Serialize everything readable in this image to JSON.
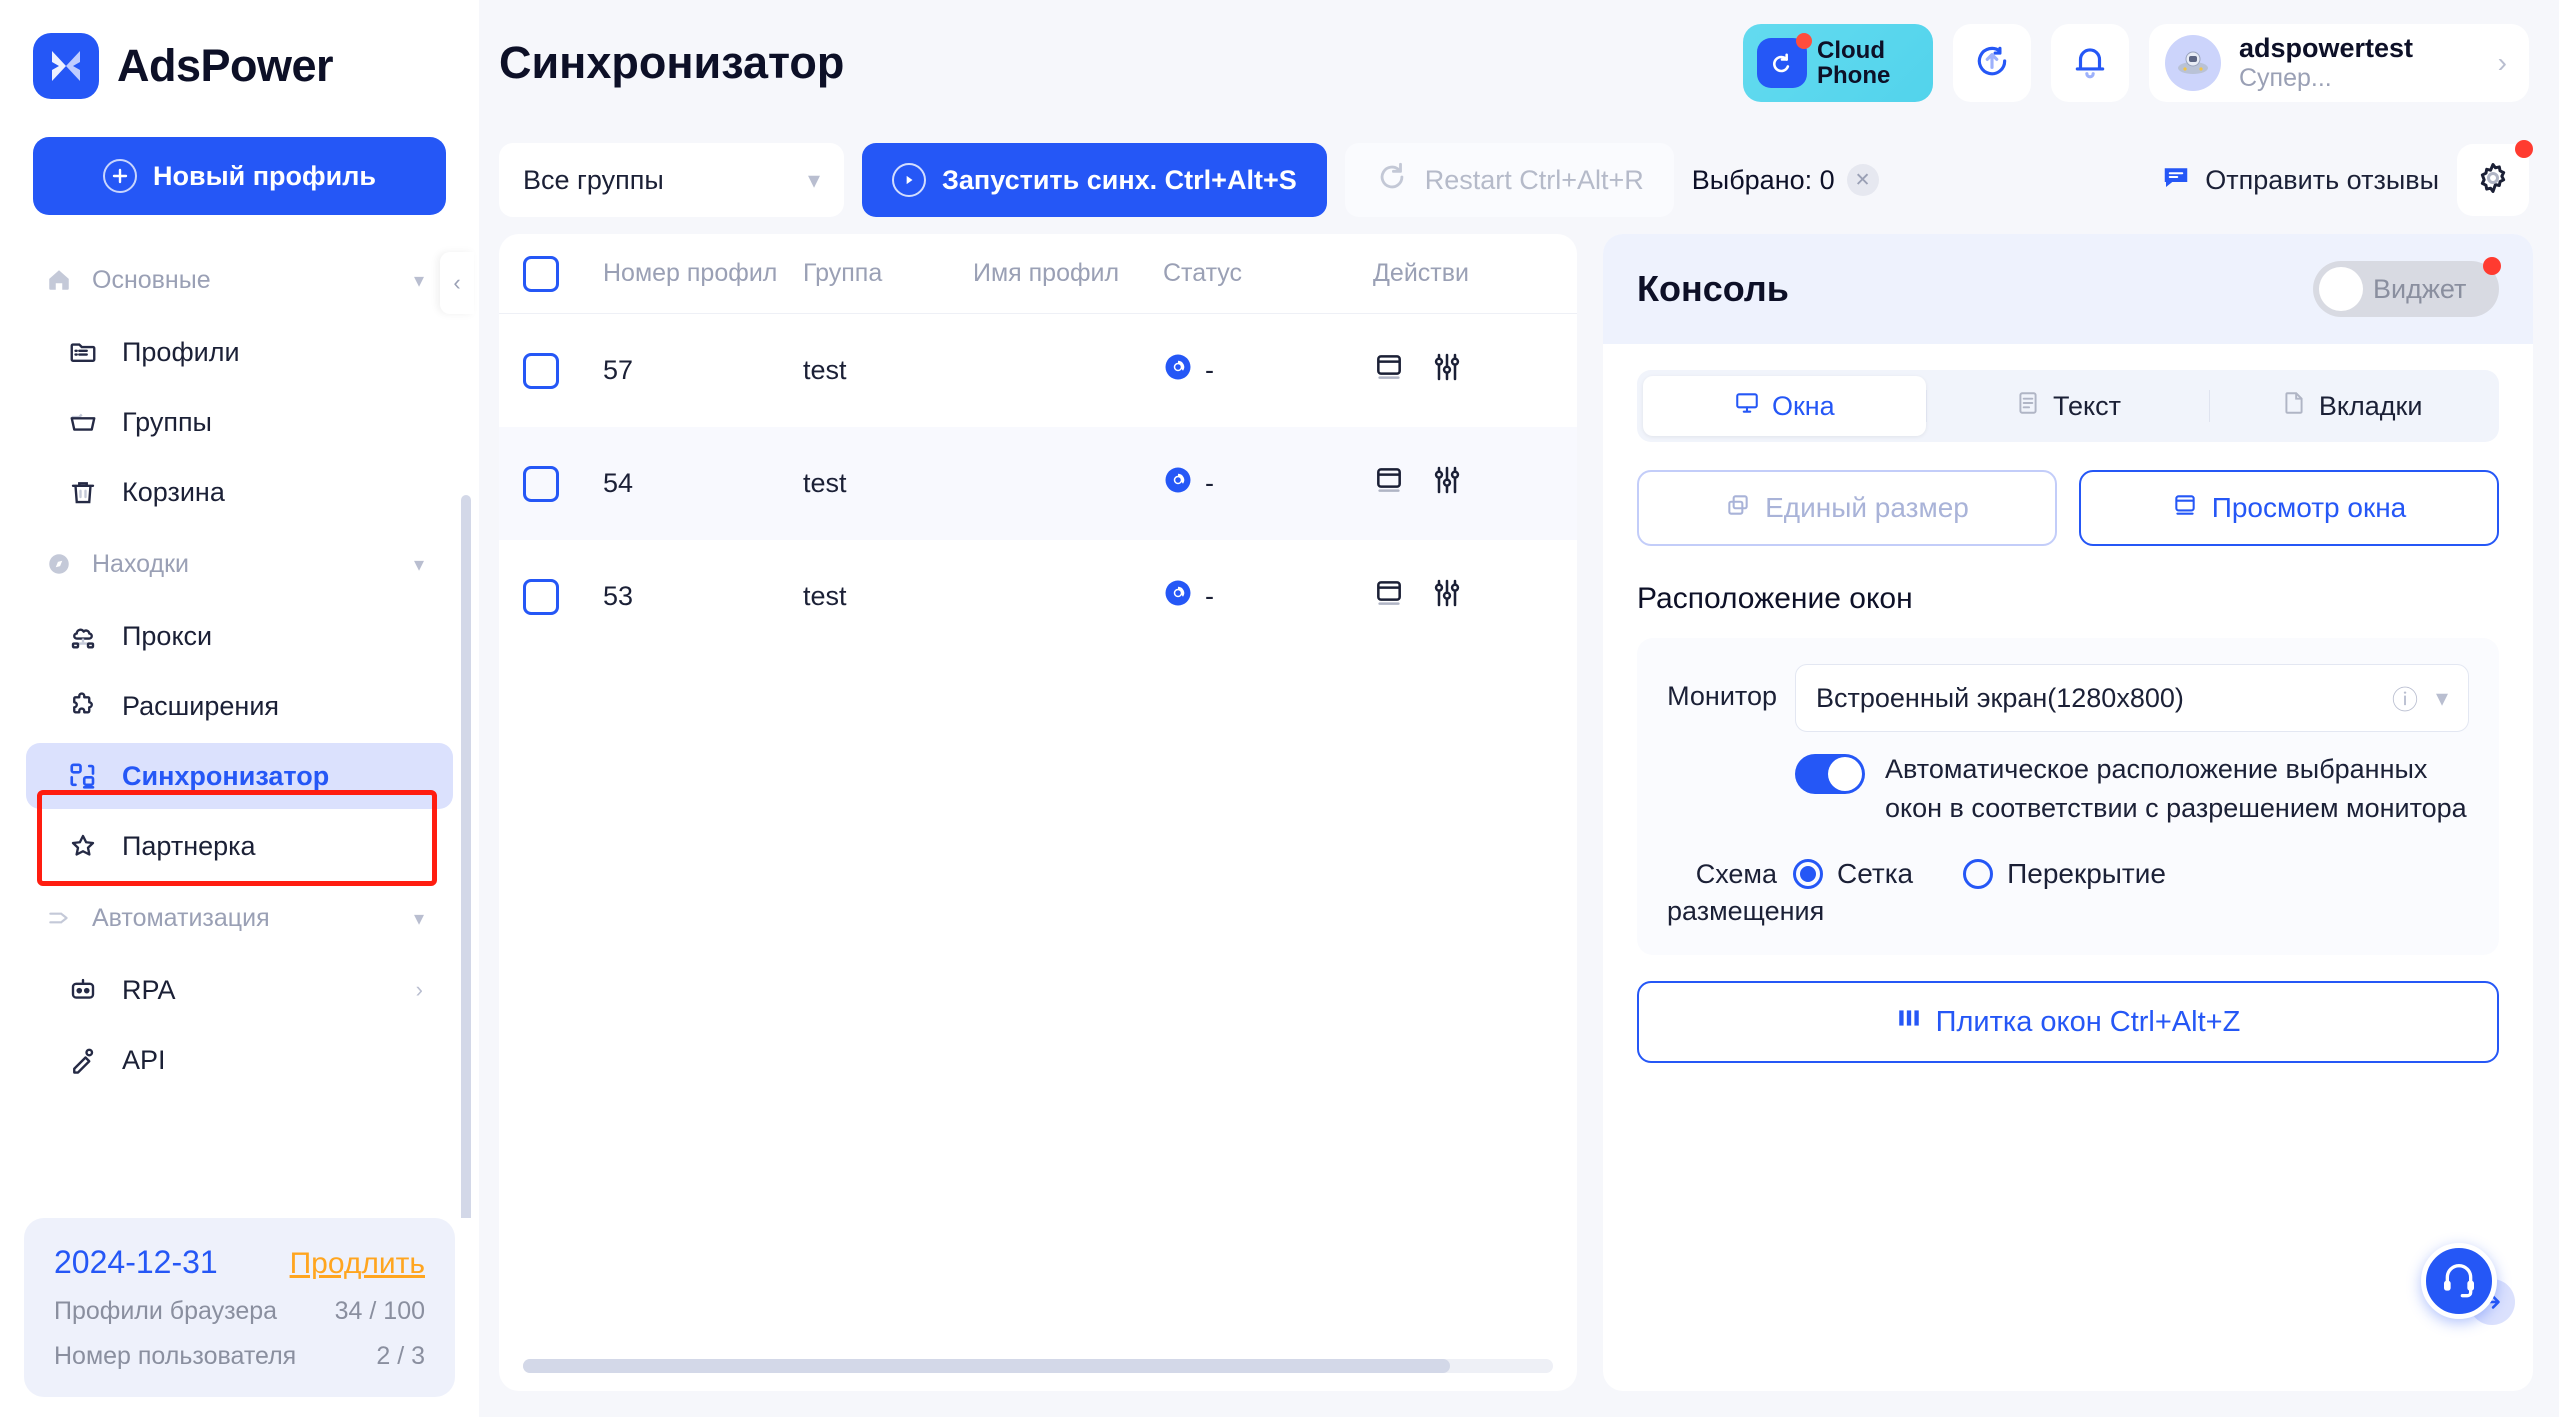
{
  "brand": {
    "name": "AdsPower",
    "logo_icon": "adspower-logo-icon"
  },
  "sidebar": {
    "new_profile_label": "Новый профиль",
    "groups": [
      {
        "title": "Основные",
        "icon": "home-icon",
        "items": [
          {
            "label": "Профили",
            "icon": "folder-list-icon"
          },
          {
            "label": "Группы",
            "icon": "folder-icon"
          },
          {
            "label": "Корзина",
            "icon": "trash-icon"
          }
        ]
      },
      {
        "title": "Находки",
        "icon": "compass-icon",
        "items": [
          {
            "label": "Прокси",
            "icon": "proxy-cloud-icon"
          },
          {
            "label": "Расширения",
            "icon": "puzzle-icon"
          },
          {
            "label": "Синхронизатор",
            "icon": "sync-grid-icon",
            "active": true
          },
          {
            "label": "Партнерка",
            "icon": "star-icon"
          }
        ]
      },
      {
        "title": "Автоматизация",
        "icon": "automation-icon",
        "items": [
          {
            "label": "RPA",
            "icon": "robot-icon",
            "has_submenu": true
          },
          {
            "label": "API",
            "icon": "api-icon"
          }
        ]
      }
    ],
    "plan": {
      "date": "2024-12-31",
      "renew_label": "Продлить",
      "rows": [
        {
          "label": "Профили браузера",
          "value": "34 / 100"
        },
        {
          "label": "Номер пользователя",
          "value": "2 / 3"
        }
      ]
    }
  },
  "header": {
    "title": "Синхронизатор",
    "cloud_phone": {
      "line1": "Cloud",
      "line2": "Phone",
      "icon": "cloud-phone-icon"
    },
    "sync_icon": "sync-upload-icon",
    "bell_icon": "bell-icon",
    "user": {
      "name": "adspowertest",
      "role": "Супер...",
      "avatar_icon": "astronaut-avatar-icon"
    }
  },
  "toolbar": {
    "group_select": "Все группы",
    "start_sync_label": "Запустить синх. Ctrl+Alt+S",
    "restart_label": "Restart Ctrl+Alt+R",
    "selected_label": "Выбрано: 0",
    "feedback_label": "Отправить отзывы",
    "settings_icon": "gear-icon"
  },
  "table": {
    "columns": [
      "Номер профил",
      "Группа",
      "Имя профил",
      "Статус",
      "Действи"
    ],
    "rows": [
      {
        "number": "57",
        "group": "test",
        "name": "",
        "status": "-",
        "status_icon": "chrome-browser-icon"
      },
      {
        "number": "54",
        "group": "test",
        "name": "",
        "status": "-",
        "status_icon": "chrome-browser-icon"
      },
      {
        "number": "53",
        "group": "test",
        "name": "",
        "status": "-",
        "status_icon": "chrome-browser-icon"
      }
    ],
    "action_icons": [
      "window-icon",
      "settings-sliders-icon"
    ]
  },
  "console": {
    "title": "Консоль",
    "widget_toggle_label": "Виджет",
    "tabs": [
      {
        "label": "Окна",
        "icon": "monitor-icon",
        "active": true
      },
      {
        "label": "Текст",
        "icon": "text-doc-icon",
        "active": false
      },
      {
        "label": "Вкладки",
        "icon": "tabs-icon",
        "active": false
      }
    ],
    "mode_buttons": [
      {
        "label": "Единый размер",
        "icon": "copy-windows-icon",
        "selected": false
      },
      {
        "label": "Просмотр окна",
        "icon": "window-preview-icon",
        "selected": true
      }
    ],
    "layout_section_title": "Расположение окон",
    "monitor_label": "Монитор",
    "monitor_value": "Встроенный экран(1280x800)",
    "auto_toggle_on": true,
    "auto_text": "Автоматическое расположение выбранных окон в соответствии с разрешением монитора",
    "scheme_label": "Схема размещения",
    "scheme_options": [
      {
        "label": "Сетка",
        "selected": true
      },
      {
        "label": "Перекрытие",
        "selected": false
      }
    ],
    "tile_button_label": "Плитка окон Ctrl+Alt+Z"
  },
  "support": {
    "icon": "headset-icon",
    "arrow_icon": "arrow-right-icon"
  },
  "colors": {
    "accent": "#2557f6",
    "accent_light": "#dbe1fd",
    "warning": "#ffa51f",
    "danger": "#ff3b30",
    "highlight_box": "#ff1d10",
    "text": "#0d1027",
    "muted": "#9aa0b5"
  }
}
